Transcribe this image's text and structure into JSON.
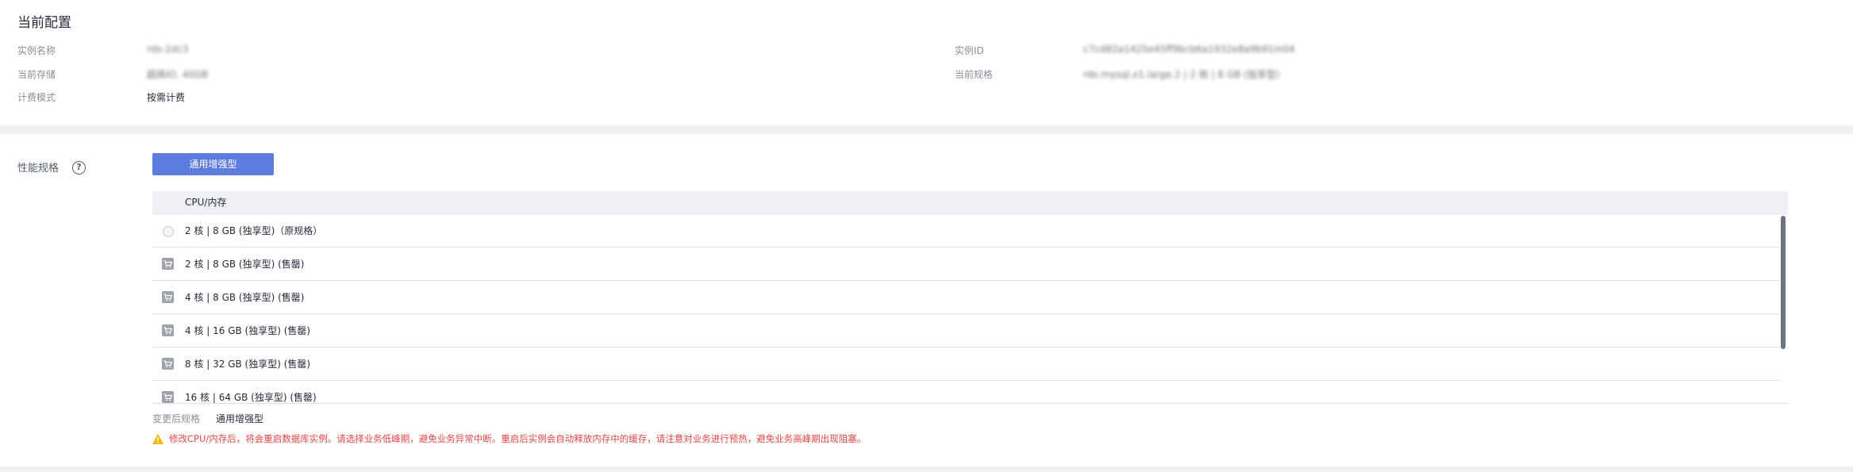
{
  "config": {
    "title": "当前配置",
    "instance_name_label": "实例名称",
    "instance_name_value": "rds-2dc3",
    "storage_label": "当前存储",
    "storage_value": "超高IO, 40GB",
    "billing_label": "计费模式",
    "billing_value": "按需计费",
    "instance_id_label": "实例ID",
    "instance_id_value": "c7cd82a1425e45ff9bcb6a1932e8a9b91in04",
    "spec_label": "当前规格",
    "spec_value": "rds.mysql.x1.large.2 | 2 核 | 8 GB (独享型)"
  },
  "performance": {
    "label": "性能规格",
    "help_icon": "?",
    "type_tab": "通用增强型",
    "table_header": "CPU/内存",
    "rows": [
      {
        "text": "2 核 | 8 GB (独享型)（原规格）",
        "icon": "radio"
      },
      {
        "text": "2 核 | 8 GB (独享型) (售罄)",
        "icon": "cart-icon"
      },
      {
        "text": "4 核 | 8 GB (独享型) (售罄)",
        "icon": "cart-icon"
      },
      {
        "text": "4 核 | 16 GB (独享型) (售罄)",
        "icon": "cart-icon"
      },
      {
        "text": "8 核 | 32 GB (独享型) (售罄)",
        "icon": "cart-icon"
      },
      {
        "text": "16 核 | 64 GB (独享型) (售罄)",
        "icon": "cart-icon"
      }
    ],
    "after_label": "变更后规格",
    "after_value": "通用增强型",
    "warning": "修改CPU/内存后，将会重启数据库实例。请选择业务低峰期，避免业务异常中断。重启后实例会自动释放内存中的缓存，请注意对业务进行预热，避免业务高峰期出现阻塞。"
  },
  "colors": {
    "accent": "#5e7ce0",
    "warning": "#e54545",
    "warning_icon": "#f5b800"
  }
}
